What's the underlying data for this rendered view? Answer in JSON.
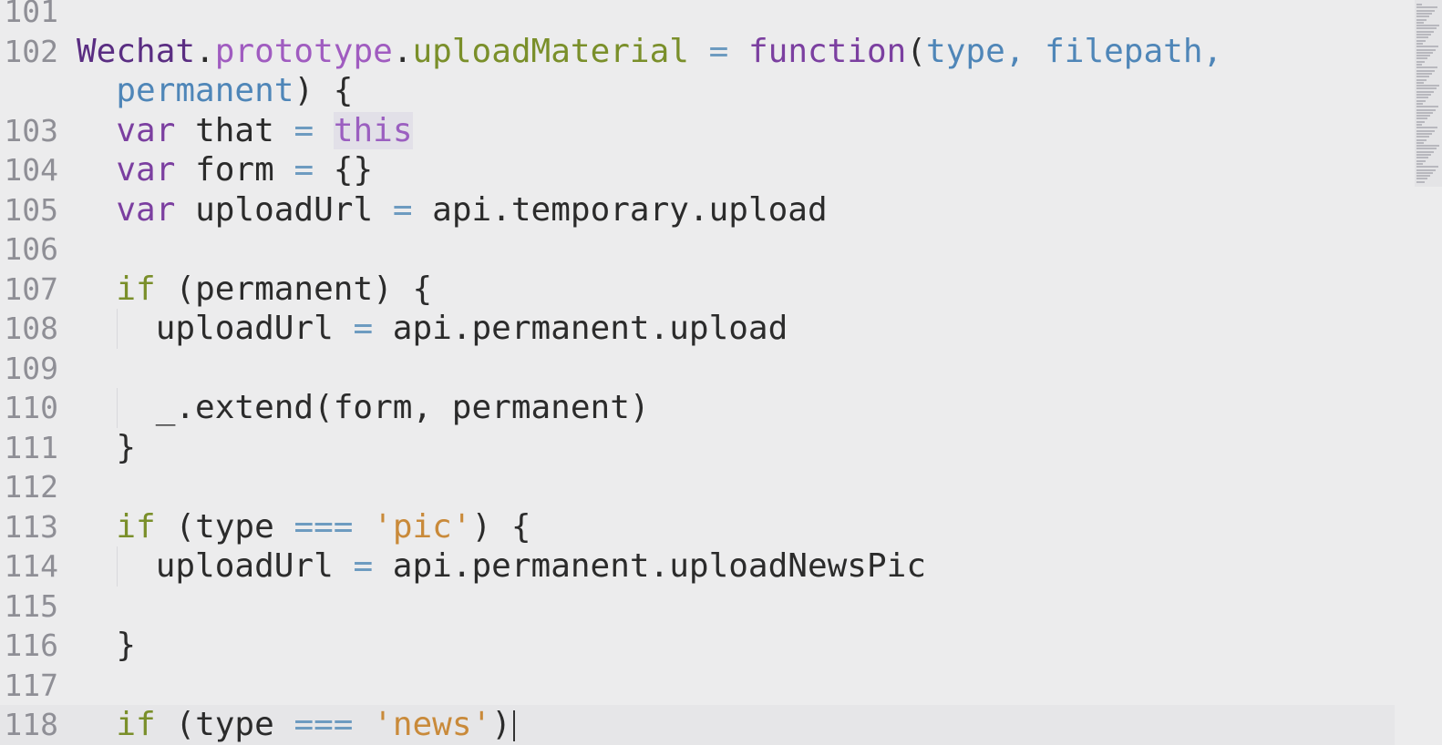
{
  "editor": {
    "lines": [
      {
        "num": "101",
        "tokens": []
      },
      {
        "num": "102",
        "tokens": [
          {
            "t": "Wechat",
            "c": "obj"
          },
          {
            "t": ".",
            "c": "plain"
          },
          {
            "t": "prototype",
            "c": "prop"
          },
          {
            "t": ".",
            "c": "plain"
          },
          {
            "t": "uploadMaterial",
            "c": "fn"
          },
          {
            "t": " = ",
            "c": "op"
          },
          {
            "t": "function",
            "c": "kw"
          },
          {
            "t": "(",
            "c": "plain"
          },
          {
            "t": "type",
            "c": "param"
          },
          {
            "t": ", ",
            "c": "param"
          },
          {
            "t": "filepath",
            "c": "param"
          },
          {
            "t": ",",
            "c": "param"
          }
        ]
      },
      {
        "num": "",
        "wrap": true,
        "tokens": [
          {
            "t": "  ",
            "c": "plain"
          },
          {
            "t": "permanent",
            "c": "param"
          },
          {
            "t": ") {",
            "c": "plain"
          }
        ]
      },
      {
        "num": "103",
        "tokens": [
          {
            "t": "  ",
            "c": "plain"
          },
          {
            "t": "var",
            "c": "kw"
          },
          {
            "t": " that ",
            "c": "plain"
          },
          {
            "t": "=",
            "c": "op"
          },
          {
            "t": " ",
            "c": "plain"
          },
          {
            "t": "this",
            "c": "this-kw"
          }
        ]
      },
      {
        "num": "104",
        "tokens": [
          {
            "t": "  ",
            "c": "plain"
          },
          {
            "t": "var",
            "c": "kw"
          },
          {
            "t": " form ",
            "c": "plain"
          },
          {
            "t": "=",
            "c": "op"
          },
          {
            "t": " {}",
            "c": "plain"
          }
        ]
      },
      {
        "num": "105",
        "tokens": [
          {
            "t": "  ",
            "c": "plain"
          },
          {
            "t": "var",
            "c": "kw"
          },
          {
            "t": " uploadUrl ",
            "c": "plain"
          },
          {
            "t": "=",
            "c": "op"
          },
          {
            "t": " api.temporary.upload",
            "c": "plain"
          }
        ]
      },
      {
        "num": "106",
        "tokens": []
      },
      {
        "num": "107",
        "tokens": [
          {
            "t": "  ",
            "c": "plain"
          },
          {
            "t": "if",
            "c": "fn"
          },
          {
            "t": " (permanent) {",
            "c": "plain"
          }
        ]
      },
      {
        "num": "108",
        "guide": true,
        "tokens": [
          {
            "t": "    uploadUrl ",
            "c": "plain"
          },
          {
            "t": "=",
            "c": "op"
          },
          {
            "t": " api.permanent.upload",
            "c": "plain"
          }
        ]
      },
      {
        "num": "109",
        "guide": true,
        "tokens": []
      },
      {
        "num": "110",
        "guide": true,
        "tokens": [
          {
            "t": "    _.extend(form, permanent)",
            "c": "plain"
          }
        ]
      },
      {
        "num": "111",
        "tokens": [
          {
            "t": "  }",
            "c": "plain"
          }
        ]
      },
      {
        "num": "112",
        "tokens": []
      },
      {
        "num": "113",
        "tokens": [
          {
            "t": "  ",
            "c": "plain"
          },
          {
            "t": "if",
            "c": "fn"
          },
          {
            "t": " (type ",
            "c": "plain"
          },
          {
            "t": "===",
            "c": "op"
          },
          {
            "t": " ",
            "c": "plain"
          },
          {
            "t": "'pic'",
            "c": "str"
          },
          {
            "t": ") {",
            "c": "plain"
          }
        ]
      },
      {
        "num": "114",
        "guide": true,
        "tokens": [
          {
            "t": "    uploadUrl ",
            "c": "plain"
          },
          {
            "t": "=",
            "c": "op"
          },
          {
            "t": " api.permanent.uploadNewsPic",
            "c": "plain"
          }
        ]
      },
      {
        "num": "115",
        "guide": true,
        "tokens": []
      },
      {
        "num": "116",
        "tokens": [
          {
            "t": "  }",
            "c": "plain"
          }
        ]
      },
      {
        "num": "117",
        "tokens": []
      },
      {
        "num": "118",
        "current": true,
        "cursor": true,
        "tokens": [
          {
            "t": "  ",
            "c": "plain"
          },
          {
            "t": "if",
            "c": "fn"
          },
          {
            "t": " (type ",
            "c": "plain"
          },
          {
            "t": "===",
            "c": "op"
          },
          {
            "t": " ",
            "c": "plain"
          },
          {
            "t": "'news'",
            "c": "str"
          },
          {
            "t": ")",
            "c": "plain"
          }
        ]
      }
    ]
  },
  "colors": {
    "background": "#ececed",
    "keyword": "#7b3fa0",
    "function_name": "#7a8f2a",
    "parameter": "#4f86b8",
    "string": "#c98a3a",
    "line_number": "#8f8f96"
  }
}
